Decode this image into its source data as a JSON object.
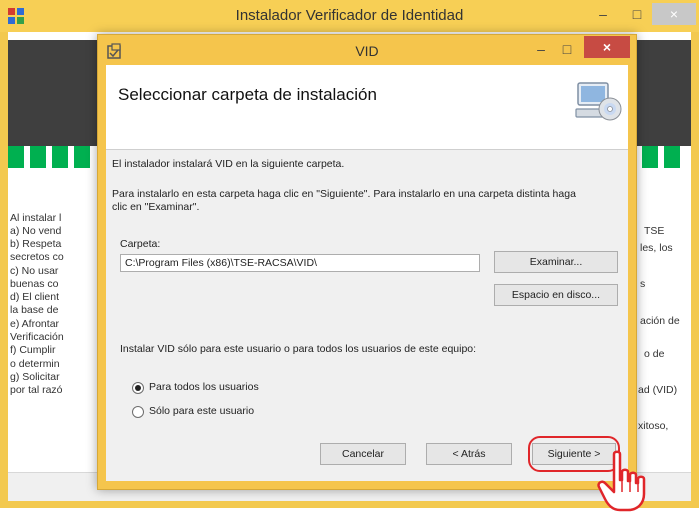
{
  "outer_window": {
    "title": "Instalador Verificador de Identidad",
    "controls": {
      "minimize": "–",
      "maximize": "□",
      "close": "×"
    },
    "left_text": [
      "Al instalar l",
      "a) No vend",
      "b) Respeta",
      "secretos co",
      "c) No usar",
      "buenas co",
      "d) El client",
      "la base de",
      "e) Afrontar",
      "Verificación",
      "f) Cumplir",
      "o determin",
      "g) Solicitar",
      "por tal razó"
    ],
    "right_text": [
      "TSE",
      "les, los",
      "s",
      "ación de",
      "o de",
      "ad (VID)",
      "xitoso,"
    ]
  },
  "dialog": {
    "title": "VID",
    "controls": {
      "minimize": "–",
      "maximize": "□",
      "close": "×"
    },
    "heading": "Seleccionar carpeta de instalación",
    "intro": "El instalador instalará VID en la siguiente carpeta.",
    "instructions_line1": "Para instalarlo en esta carpeta haga clic en \"Siguiente\". Para instalarlo en una carpeta distinta haga",
    "instructions_line2": "clic en \"Examinar\".",
    "folder_label": "Carpeta:",
    "folder_value": "C:\\Program Files (x86)\\TSE-RACSA\\VID\\",
    "browse_button": "Examinar...",
    "disk_space_button": "Espacio en disco...",
    "scope_question": "Instalar VID sólo para este usuario o para todos los usuarios de este equipo:",
    "radio_all_users": "Para todos los usuarios",
    "radio_this_user": "Sólo para este usuario",
    "selected_option": "Para todos los usuarios",
    "cancel_button": "Cancelar",
    "back_button": "< Atrás",
    "next_button": "Siguiente >"
  },
  "colors": {
    "title_bar": "#f5c54c",
    "close_button": "#c74b43",
    "highlight": "#e0262a",
    "banner_green": "#00b050"
  },
  "icons": [
    "app-icon",
    "installer-icon",
    "computer-cd-icon",
    "hand-cursor-icon"
  ]
}
